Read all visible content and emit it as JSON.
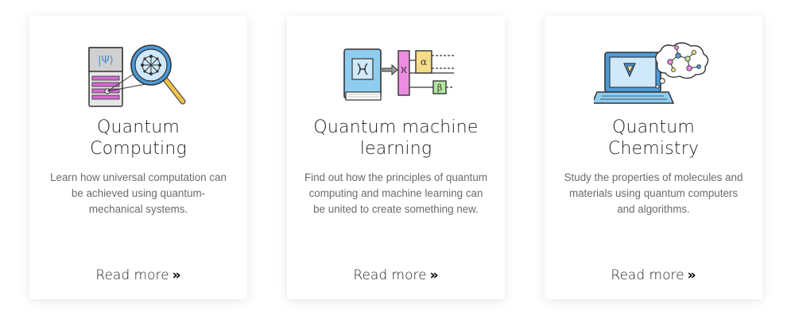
{
  "cards": [
    {
      "illustration_icon": "quantum-computer-magnifier-icon",
      "illustration_text": "|Ψ⟩",
      "title_line1": "Quantum",
      "title_line2": "Computing",
      "description": "Learn how universal computation can be achieved using quantum-mechanical systems.",
      "read_more_label": "Read more",
      "read_more_icon": "double-chevron-right-icon"
    },
    {
      "illustration_icon": "quantum-machine-learning-book-icon",
      "illustration_text_alpha": "α",
      "illustration_text_beta": "β",
      "title_line1": "Quantum machine",
      "title_line2": "learning",
      "description": "Find out how the principles of quantum computing and machine learning can be united to create something new.",
      "read_more_label": "Read more",
      "read_more_icon": "double-chevron-right-icon"
    },
    {
      "illustration_icon": "laptop-molecule-icon",
      "title_line1": "Quantum",
      "title_line2": "Chemistry",
      "description": "Study the properties of molecules and materials using quantum computers and algorithms.",
      "read_more_label": "Read more",
      "read_more_icon": "double-chevron-right-icon"
    }
  ],
  "colors": {
    "card_background": "#ffffff",
    "title_text": "#222222",
    "description_text": "#6b6b6b",
    "illustration_blue": "#8ecdf0",
    "illustration_pink": "#ec8de2",
    "illustration_yellow": "#f6dc8a",
    "illustration_green": "#b6e6a0"
  }
}
